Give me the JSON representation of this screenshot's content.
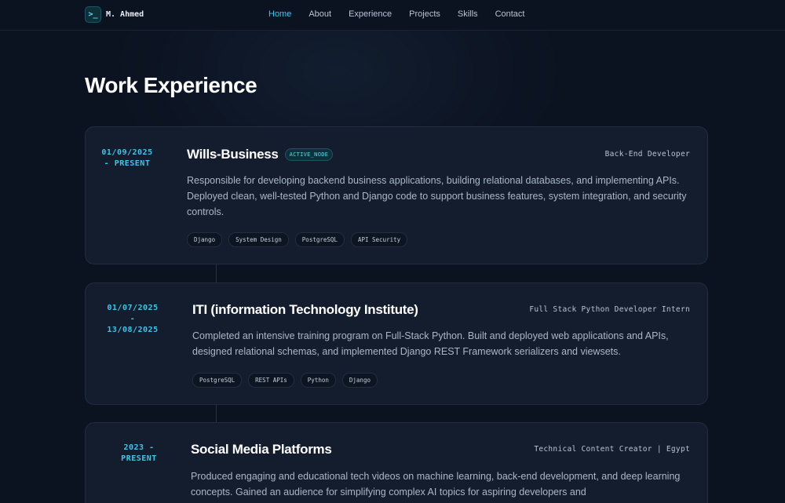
{
  "brand": {
    "icon": "terminal-prompt-icon",
    "icon_glyph": ">_",
    "name": "M. Ahmed"
  },
  "nav": {
    "items": [
      {
        "label": "Home",
        "active": true
      },
      {
        "label": "About",
        "active": false
      },
      {
        "label": "Experience",
        "active": false
      },
      {
        "label": "Projects",
        "active": false
      },
      {
        "label": "Skills",
        "active": false
      },
      {
        "label": "Contact",
        "active": false
      }
    ]
  },
  "section": {
    "title": "Work Experience"
  },
  "colors": {
    "accent": "#3cc6ec",
    "background": "#0b1220",
    "card": "#141d2d"
  },
  "experiences": [
    {
      "date_line1": "01/09/2025",
      "date_line2": "- PRESENT",
      "date_line3": "",
      "company": "Wills-Business",
      "badge": "ACTIVE_NODE",
      "role": "Back-End Developer",
      "description": "Responsible for developing backend business applications, building relational databases, and implementing APIs. Deployed clean, well-tested Python and Django code to support business features, system integration, and security controls.",
      "tags": [
        "Django",
        "System Design",
        "PostgreSQL",
        "API Security"
      ]
    },
    {
      "date_line1": "01/07/2025",
      "date_line2": "-",
      "date_line3": "13/08/2025",
      "company": "ITI (information Technology Institute)",
      "badge": "",
      "role": "Full Stack Python Developer Intern",
      "description": "Completed an intensive training program on Full-Stack Python. Built and deployed web applications and APIs, designed relational schemas, and implemented Django REST Framework serializers and viewsets.",
      "tags": [
        "PostgreSQL",
        "REST APIs",
        "Python",
        "Django"
      ]
    },
    {
      "date_line1": "2023 -",
      "date_line2": "PRESENT",
      "date_line3": "",
      "company": "Social Media Platforms",
      "badge": "",
      "role": "Technical Content Creator | Egypt",
      "description": "Produced engaging and educational tech videos on machine learning, back-end development, and deep learning concepts. Gained an audience for simplifying complex AI topics for aspiring developers and",
      "tags": []
    }
  ]
}
